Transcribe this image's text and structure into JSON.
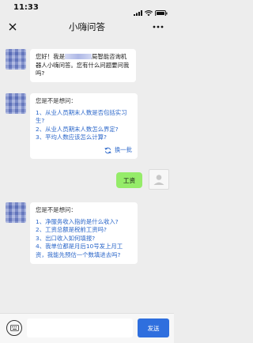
{
  "status_bar": {
    "time": "11:33"
  },
  "nav": {
    "title": "小嗨问答",
    "close_icon": "close-icon",
    "more_icon": "more-dots-icon"
  },
  "messages": {
    "greeting": {
      "prefix": "您好！我是",
      "suffix": "局智能咨询机器人小嗨问答。您有什么问题要问我吗?"
    },
    "suggestions_1": {
      "hint": "您是不是想问：",
      "questions": [
        "1、从业人员期末人数是否包括实习生?",
        "2、从业人员期末人数怎么界定?",
        "3、平均人数应该怎么计算?"
      ],
      "refresh_label": "换一批"
    },
    "user_message": "工资",
    "suggestions_2": {
      "hint": "您是不是想问：",
      "questions": [
        "1、净服务收入指的是什么收入?",
        "2、工资总额是税前工资吗?",
        "3、出口收入如何填报?",
        "4、我单位都是月后10号发上月工资，我能先预估一个数填进去吗?"
      ]
    }
  },
  "input_bar": {
    "placeholder": "",
    "send_label": "发送",
    "keyboard_icon": "keyboard-icon"
  },
  "colors": {
    "background": "#ededed",
    "user_bubble": "#95ec69",
    "link_blue": "#2a66c9",
    "send_button": "#2f6fde"
  }
}
